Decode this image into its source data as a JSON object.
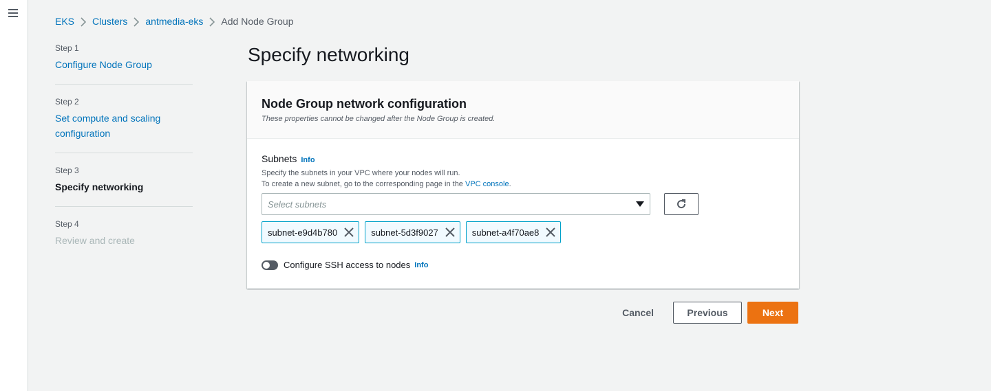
{
  "breadcrumb": {
    "items": [
      "EKS",
      "Clusters",
      "antmedia-eks"
    ],
    "current": "Add Node Group"
  },
  "steps": [
    {
      "number": "Step 1",
      "title": "Configure Node Group"
    },
    {
      "number": "Step 2",
      "title": "Set compute and scaling configuration"
    },
    {
      "number": "Step 3",
      "title": "Specify networking"
    },
    {
      "number": "Step 4",
      "title": "Review and create"
    }
  ],
  "page_title": "Specify networking",
  "panel": {
    "title": "Node Group network configuration",
    "description": "These properties cannot be changed after the Node Group is created."
  },
  "subnets": {
    "label": "Subnets",
    "info": "Info",
    "desc_line1": "Specify the subnets in your VPC where your nodes will run.",
    "desc_line2_prefix": "To create a new subnet, go to the corresponding page in the ",
    "desc_line2_link": "VPC console",
    "desc_line2_suffix": ".",
    "placeholder": "Select subnets",
    "selected": [
      "subnet-e9d4b780",
      "subnet-5d3f9027",
      "subnet-a4f70ae8"
    ]
  },
  "ssh": {
    "label": "Configure SSH access to nodes",
    "info": "Info",
    "enabled": false
  },
  "actions": {
    "cancel": "Cancel",
    "previous": "Previous",
    "next": "Next"
  },
  "colors": {
    "link": "#0073bb",
    "primary": "#ec7211",
    "token_border": "#00a1c9",
    "token_bg": "#f1faff"
  },
  "icons": [
    "menu-icon",
    "chevron-right-icon",
    "refresh-icon",
    "close-icon",
    "caret-down-icon"
  ]
}
